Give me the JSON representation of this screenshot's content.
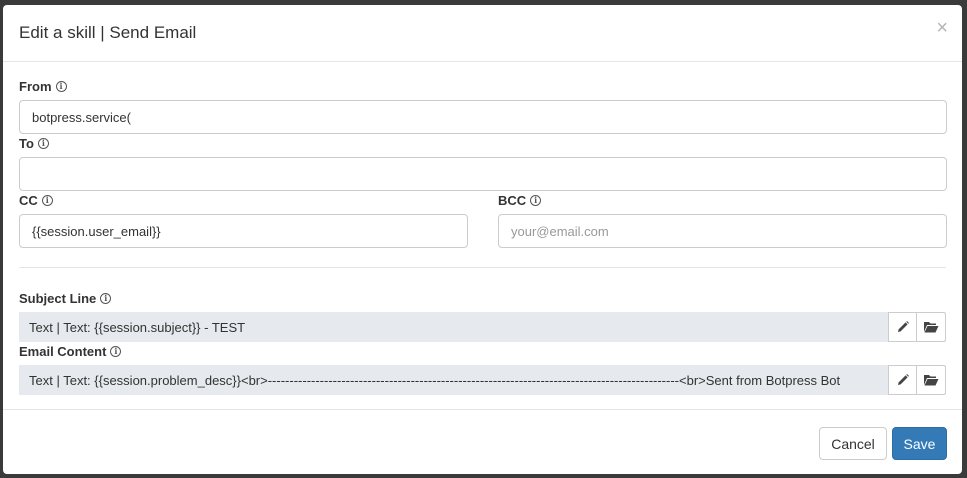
{
  "modal": {
    "title": "Edit a skill | Send Email",
    "close_symbol": "×"
  },
  "info_symbol": "i",
  "form": {
    "from": {
      "label": "From",
      "value": "botpress.service("
    },
    "to": {
      "label": "To",
      "value": ""
    },
    "cc": {
      "label": "CC",
      "value": "{{session.user_email}}"
    },
    "bcc": {
      "label": "BCC",
      "value": "",
      "placeholder": "your@email.com"
    },
    "subject": {
      "label": "Subject Line",
      "value": "Text | Text: {{session.subject}} - TEST"
    },
    "content": {
      "label": "Email Content",
      "value": "Text | Text: {{session.problem_desc}}<br>-----------------------------------------------------------------------------------------------<br>Sent from Botpress Bot"
    }
  },
  "icons": {
    "edit": "pencil-icon",
    "browse": "folder-open-icon",
    "info": "info-icon",
    "close": "close-icon"
  },
  "footer": {
    "cancel_label": "Cancel",
    "save_label": "Save"
  },
  "colors": {
    "primary": "#337ab7",
    "readonly_bg": "#e6e9ed"
  }
}
